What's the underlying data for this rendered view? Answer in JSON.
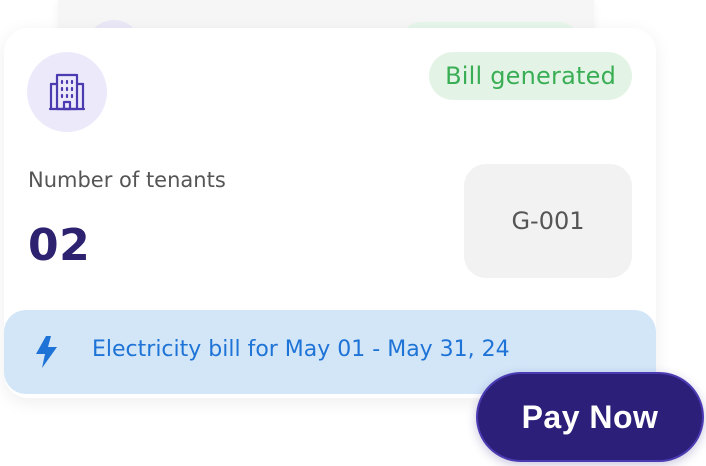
{
  "card": {
    "status_badge": "Bill generated",
    "tenants_label": "Number of tenants",
    "tenants_count": "02",
    "unit_id": "G-001",
    "bill_text": "Electricity bill for May 01 - May 31, 24",
    "building_icon": "building-icon",
    "bolt_icon": "lightning-bolt-icon"
  },
  "actions": {
    "pay_now_label": "Pay Now"
  },
  "colors": {
    "primary": "#2c1f7a",
    "status_green": "#3aae55",
    "status_green_bg": "#e3f4e6",
    "bill_blue": "#1e73d6",
    "bill_bg": "#d3e6f8",
    "icon_bg": "#ece9fb",
    "icon_stroke": "#4b3bb0"
  }
}
